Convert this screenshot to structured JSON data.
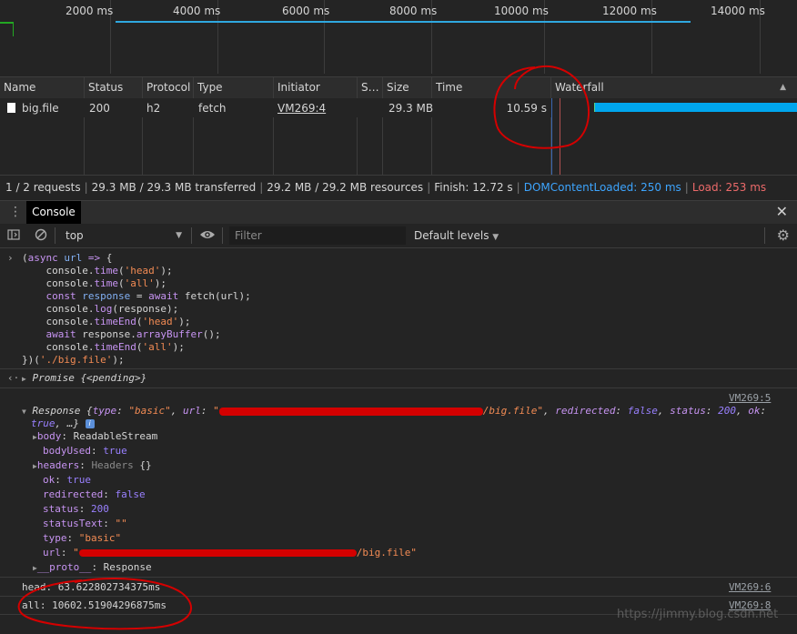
{
  "timeline": {
    "ticks": [
      "2000 ms",
      "4000 ms",
      "6000 ms",
      "8000 ms",
      "10000 ms",
      "12000 ms",
      "14000 ms"
    ]
  },
  "network": {
    "columns": [
      "Name",
      "Status",
      "Protocol",
      "Type",
      "Initiator",
      "S…",
      "Size",
      "Time",
      "Waterfall"
    ],
    "row": {
      "name": "big.file",
      "status": "200",
      "protocol": "h2",
      "type": "fetch",
      "initiator": "VM269:4",
      "size": "29.3 MB",
      "time": "10.59 s"
    },
    "sort_indicator": "▲"
  },
  "summary": {
    "requests": "1 / 2 requests",
    "transferred": "29.3 MB / 29.3 MB transferred",
    "resources": "29.2 MB / 29.2 MB resources",
    "finish": "Finish: 12.72 s",
    "dcl": "DOMContentLoaded: 250 ms",
    "load": "Load: 253 ms",
    "colors": {
      "dcl": "#3da5ff",
      "load": "#ec6a6a"
    }
  },
  "drawer": {
    "tab_label": "Console",
    "context": "top",
    "filter_placeholder": "Filter",
    "levels": "Default levels"
  },
  "console": {
    "code_lines": [
      "(async url => {",
      "    console.time('head');",
      "    console.time('all');",
      "    const response = await fetch(url);",
      "    console.log(response);",
      "    console.timeEnd('head');",
      "    await response.arrayBuffer();",
      "    console.timeEnd('all');",
      "})('./big.file');"
    ],
    "promise_label": "Promise",
    "promise_state": "{<pending>}",
    "response_summary_prefix": "Response {type: \"basic\", url: \"",
    "response_url_tail": "/big.file\"",
    "response_summary_suffix": ", redirected: false, status: 200, ok:",
    "response_summary_line2": "true, …}",
    "response_link": "VM269:5",
    "props": [
      {
        "key": "body",
        "value": "ReadableStream",
        "expandable": true
      },
      {
        "key": "bodyUsed",
        "value": "true",
        "expandable": false
      },
      {
        "key": "headers",
        "value": "Headers {}",
        "expandable": true
      },
      {
        "key": "ok",
        "value": "true",
        "expandable": false
      },
      {
        "key": "redirected",
        "value": "false",
        "expandable": false
      },
      {
        "key": "status",
        "value": "200",
        "expandable": false
      },
      {
        "key": "statusText",
        "value": "\"\"",
        "expandable": false
      },
      {
        "key": "type",
        "value": "\"basic\"",
        "expandable": false
      },
      {
        "key": "url",
        "value": "/big.file\"",
        "expandable": false
      },
      {
        "key": "__proto__",
        "value": "Response",
        "expandable": true
      }
    ],
    "head_line": "head: 63.622802734375ms",
    "head_link": "VM269:6",
    "all_line": "all: 10602.51904296875ms",
    "all_link": "VM269:8"
  },
  "watermark": "https://jimmy.blog.csdn.net"
}
